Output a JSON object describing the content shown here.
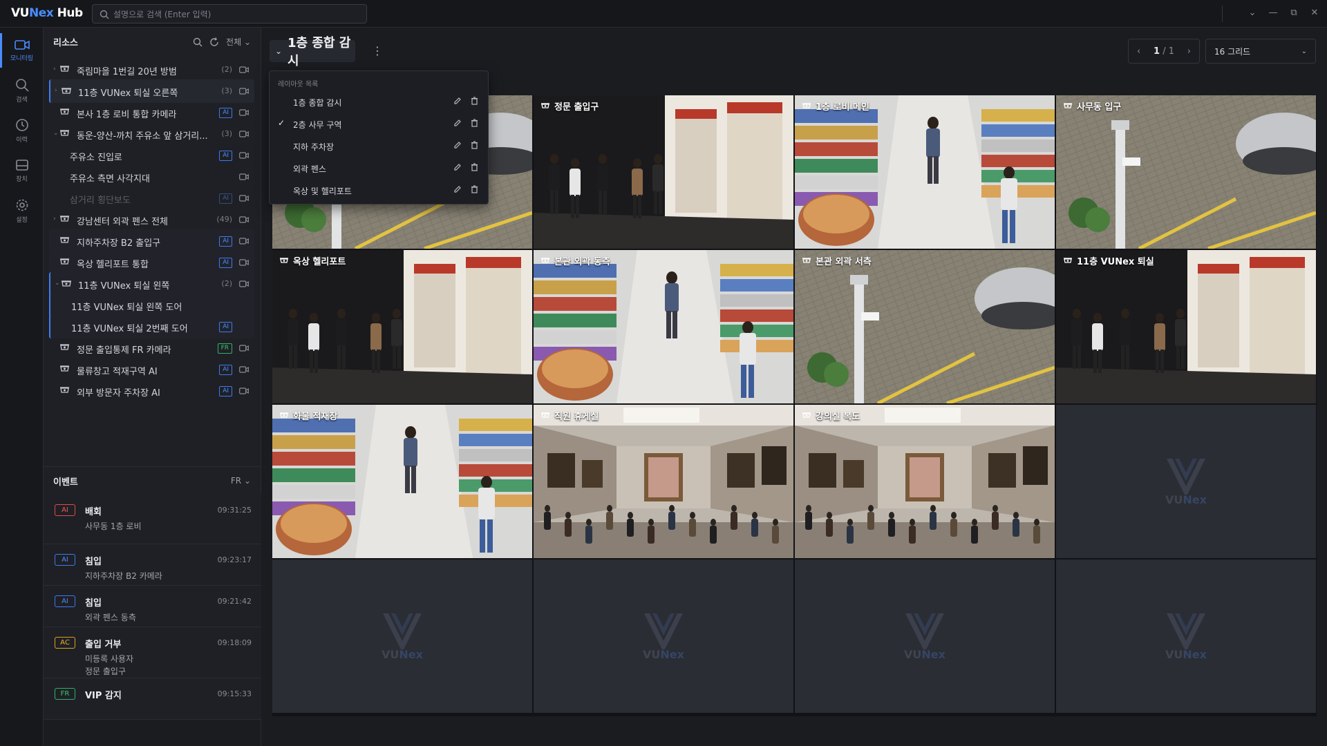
{
  "app": {
    "logo_prefix": "VU",
    "logo_brand": "Nex",
    "logo_suffix": " Hub"
  },
  "search": {
    "placeholder": "설명으로 검색 (Enter 입력)"
  },
  "nav": [
    {
      "label": "모니터링",
      "icon": "camera-icon",
      "active": true
    },
    {
      "label": "검색",
      "icon": "search-icon"
    },
    {
      "label": "이력",
      "icon": "history-icon"
    },
    {
      "label": "장치",
      "icon": "device-icon"
    },
    {
      "label": "설정",
      "icon": "gear-icon"
    }
  ],
  "resources": {
    "title": "리소스",
    "filter": "전체",
    "items": [
      {
        "label": "죽림마을 1번길 20년 방범",
        "count": "(2)",
        "type": "group"
      },
      {
        "label": "11층 VUNex 퇴실 오른쪽",
        "count": "(3)",
        "type": "group-selected"
      },
      {
        "label": "본사 1층 로비 통합 카메라",
        "badge": "AI"
      },
      {
        "label": "동운-양산-까치 주유소 앞 삼거리...",
        "count": "(3)",
        "type": "group-open"
      },
      {
        "label": "주유소 진입로",
        "badge": "AI"
      },
      {
        "label": "주유소 측면 사각지대"
      },
      {
        "label": "삼거리 횡단보도",
        "badge": "AI",
        "dim": true
      },
      {
        "label": "강남센터 외곽 펜스 전체",
        "count": "(49)",
        "type": "group"
      },
      {
        "label": "지하주차장 B2 출입구",
        "badge": "AI"
      },
      {
        "label": "옥상 헬리포트 통합",
        "badge": "AI"
      },
      {
        "label": "11층 VUNex 퇴실 왼쪽",
        "count": "(2)",
        "type": "group-open"
      },
      {
        "label": "11층 VUNex 퇴실 왼쪽 도어"
      },
      {
        "label": "11층 VUNex 퇴실 2번째 도어",
        "badge": "AI"
      },
      {
        "label": "정문 출입통제 FR 카메라",
        "badge": "FR"
      },
      {
        "label": "물류창고 적재구역 AI",
        "badge": "AI"
      },
      {
        "label": "외부 방문자 주차장 AI",
        "badge": "AI"
      }
    ]
  },
  "events": {
    "title": "이벤트",
    "filter": "FR",
    "items": [
      {
        "tag": "AI",
        "title": "배회",
        "time": "09:31:25",
        "lines": [
          "사무동 1층 로비"
        ]
      },
      {
        "tag": "AI",
        "title": "침입",
        "time": "09:23:17",
        "lines": [
          "지하주차장 B2 카메라"
        ]
      },
      {
        "tag": "AI",
        "title": "침입",
        "time": "09:21:42",
        "lines": [
          "외곽 펜스 동측"
        ]
      },
      {
        "tag": "AC",
        "title": "출입 거부",
        "time": "09:18:09",
        "lines": [
          "미등록 사용자",
          "정문 출입구"
        ]
      },
      {
        "tag": "FR",
        "title": "VIP 감지",
        "time": "09:15:33",
        "lines": []
      }
    ]
  },
  "layout": {
    "title": "1층 종합 감시",
    "page_current": "1",
    "page_total": "/ 1",
    "grid_mode": "16 그리드",
    "list_header": "레이아웃 목록",
    "list": [
      {
        "name": "1층 종합 감시",
        "checked": false
      },
      {
        "name": "2층 사무 구역",
        "checked": true
      },
      {
        "name": "지하 주차장",
        "checked": false
      },
      {
        "name": "외곽 펜스",
        "checked": false
      },
      {
        "name": "옥상 및 헬리포트",
        "checked": false
      }
    ]
  },
  "tiles": [
    {
      "label": "",
      "scene": "parking"
    },
    {
      "label": "정문 출입구",
      "scene": "gallery"
    },
    {
      "label": "1층 로비 메인",
      "scene": "market"
    },
    {
      "label": "사무동 입구",
      "scene": "parking"
    },
    {
      "label": "옥상 헬리포트",
      "scene": "gallery"
    },
    {
      "label": "본관 외곽 동측",
      "scene": "market"
    },
    {
      "label": "본관 외곽 서측",
      "scene": "parking"
    },
    {
      "label": "11층 VUNex 퇴실",
      "scene": "gallery"
    },
    {
      "label": "화물 적재장",
      "scene": "market"
    },
    {
      "label": "직원 휴게실",
      "scene": "museum"
    },
    {
      "label": "강의실 복도",
      "scene": "museum"
    },
    {
      "label": "",
      "scene": "empty"
    },
    {
      "label": "",
      "scene": "empty"
    },
    {
      "label": "",
      "scene": "empty"
    },
    {
      "label": "",
      "scene": "empty"
    },
    {
      "label": "",
      "scene": "empty"
    }
  ],
  "watermark": {
    "prefix": "VU",
    "brand": "Nex"
  }
}
